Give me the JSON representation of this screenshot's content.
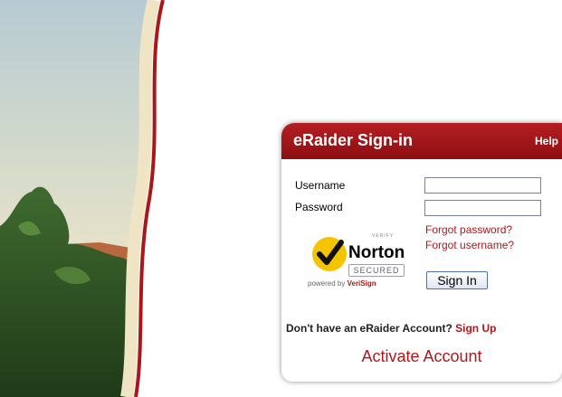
{
  "signin": {
    "title": "eRaider Sign-in",
    "help_label": "Help",
    "username_label": "Username",
    "password_label": "Password",
    "username_value": "",
    "password_value": "",
    "forgot_password": "Forgot password?",
    "forgot_username": "Forgot username?",
    "signin_button": "Sign In",
    "no_account_text": "Don't have an eRaider Account?",
    "signup_link": "Sign Up",
    "activate_link": "Activate Account"
  },
  "seal": {
    "verify": "VERIFY",
    "brand": "Norton",
    "secured": "SECURED",
    "powered_by": "powered by",
    "powered_brand": "VeriSign"
  },
  "colors": {
    "brand_red": "#a8171b",
    "link_red": "#b3151b",
    "seal_yellow": "#f5c400"
  }
}
